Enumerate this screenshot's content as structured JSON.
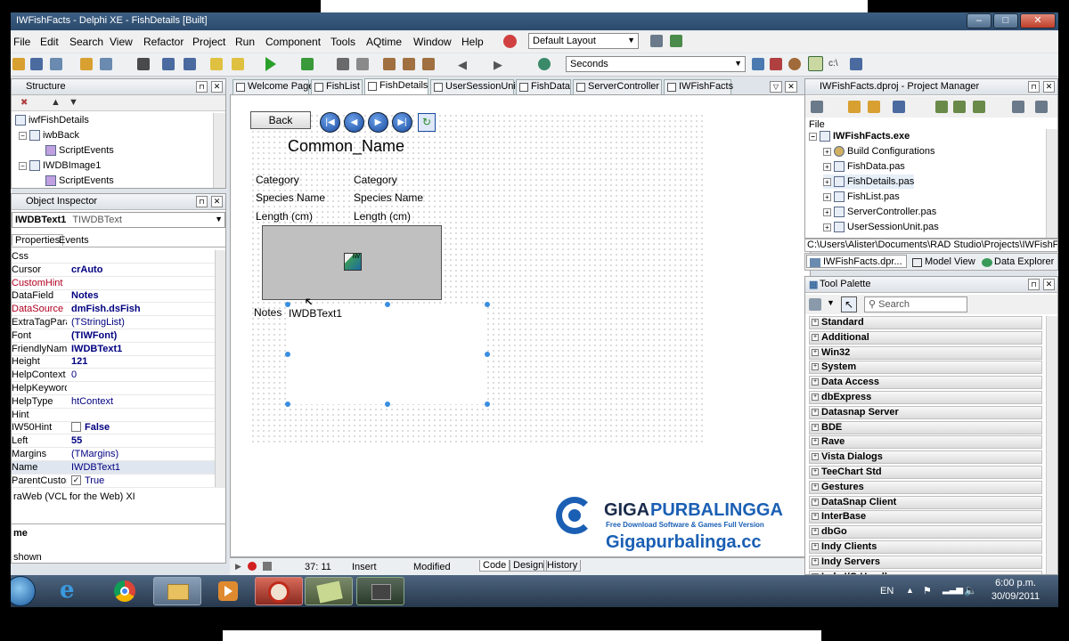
{
  "window": {
    "title": "IWFishFacts - Delphi XE - FishDetails [Built]",
    "minimize": "–",
    "maximize": "□",
    "close": "✕"
  },
  "menu": [
    "File",
    "Edit",
    "Search",
    "View",
    "Refactor",
    "Project",
    "Run",
    "Component",
    "Tools",
    "AQtime",
    "Window",
    "Help"
  ],
  "layout_combo": "Default Layout",
  "seconds_combo": "Seconds",
  "structure": {
    "title": "Structure",
    "items": [
      "iwfFishDetails",
      "iwbBack",
      "ScriptEvents",
      "IWDBImage1",
      "ScriptEvents"
    ]
  },
  "object_inspector": {
    "title": "Object Inspector",
    "selected_name": "IWDBText1",
    "selected_type": "TIWDBText",
    "tabs": [
      "Properties",
      "Events"
    ],
    "rows": [
      {
        "name": "Css",
        "value": ""
      },
      {
        "name": "Cursor",
        "value": "crAuto"
      },
      {
        "name": "CustomHint",
        "value": ""
      },
      {
        "name": "DataField",
        "value": "Notes"
      },
      {
        "name": "DataSource",
        "value": "dmFish.dsFish"
      },
      {
        "name": "ExtraTagParams",
        "value": "(TStringList)"
      },
      {
        "name": "Font",
        "value": "(TIWFont)"
      },
      {
        "name": "FriendlyName",
        "value": "IWDBText1"
      },
      {
        "name": "Height",
        "value": "121"
      },
      {
        "name": "HelpContext",
        "value": "0"
      },
      {
        "name": "HelpKeyword",
        "value": ""
      },
      {
        "name": "HelpType",
        "value": "htContext"
      },
      {
        "name": "Hint",
        "value": ""
      },
      {
        "name": "IW50Hint",
        "value": "False"
      },
      {
        "name": "Left",
        "value": "55"
      },
      {
        "name": "Margins",
        "value": "(TMargins)"
      },
      {
        "name": "Name",
        "value": "IWDBText1"
      },
      {
        "name": "ParentCustomHint",
        "value": "True"
      }
    ],
    "footer_text": "raWeb (VCL for the Web) XI",
    "footer_bold": "me",
    "footer_status": "shown"
  },
  "tabs": [
    "Welcome Page",
    "FishList",
    "FishDetails",
    "UserSessionUnit",
    "FishData",
    "ServerController",
    "IWFishFacts"
  ],
  "designer": {
    "back_button": "Back",
    "nav_buttons": [
      "|◀",
      "◀",
      "▶",
      "▶|",
      "↻"
    ],
    "common_name": "Common_Name",
    "labels": [
      "Category",
      "Species Name",
      "Length (cm)"
    ],
    "values": [
      "Category",
      "Species Name",
      "Length (cm)"
    ],
    "image_label": "IW",
    "notes_label": "Notes",
    "dbtext": "IWDBText1"
  },
  "editor_status": {
    "position": "37: 11",
    "mode": "Insert",
    "state": "Modified",
    "tabs": [
      "Code",
      "Design",
      "History"
    ]
  },
  "project_manager": {
    "title": "IWFishFacts.dproj - Project Manager",
    "file_header": "File",
    "items": [
      "IWFishFacts.exe",
      "Build Configurations",
      "FishData.pas",
      "FishDetails.pas",
      "FishList.pas",
      "ServerController.pas",
      "UserSessionUnit.pas"
    ],
    "path": "C:\\Users\\Alister\\Documents\\RAD Studio\\Projects\\IWFishFacts\\",
    "bottom_tabs": [
      "IWFishFacts.dpr...",
      "Model View",
      "Data Explorer"
    ]
  },
  "tool_palette": {
    "title": "Tool Palette",
    "search_placeholder": "Search",
    "categories": [
      "Standard",
      "Additional",
      "Win32",
      "System",
      "Data Access",
      "dbExpress",
      "Datasnap Server",
      "BDE",
      "Rave",
      "Vista Dialogs",
      "TeeChart Std",
      "Gestures",
      "DataSnap Client",
      "InterBase",
      "dbGo",
      "Indy Clients",
      "Indy Servers",
      "Indy I/O Handlers"
    ]
  },
  "watermark": {
    "brand_a": "GIGA",
    "brand_b": "PURBALINGGA",
    "tagline": "Free Download Software & Games Full Version",
    "url": "Gigapurbalinga.cc"
  },
  "taskbar": {
    "language": "EN",
    "time": "6:00 p.m.",
    "date": "30/09/2011"
  },
  "colors": {
    "taskbar": "#27384c",
    "titlebar": "#2c4a6c",
    "accent": "#1a4aa0",
    "watermark_blue": "#1a5fb4"
  }
}
